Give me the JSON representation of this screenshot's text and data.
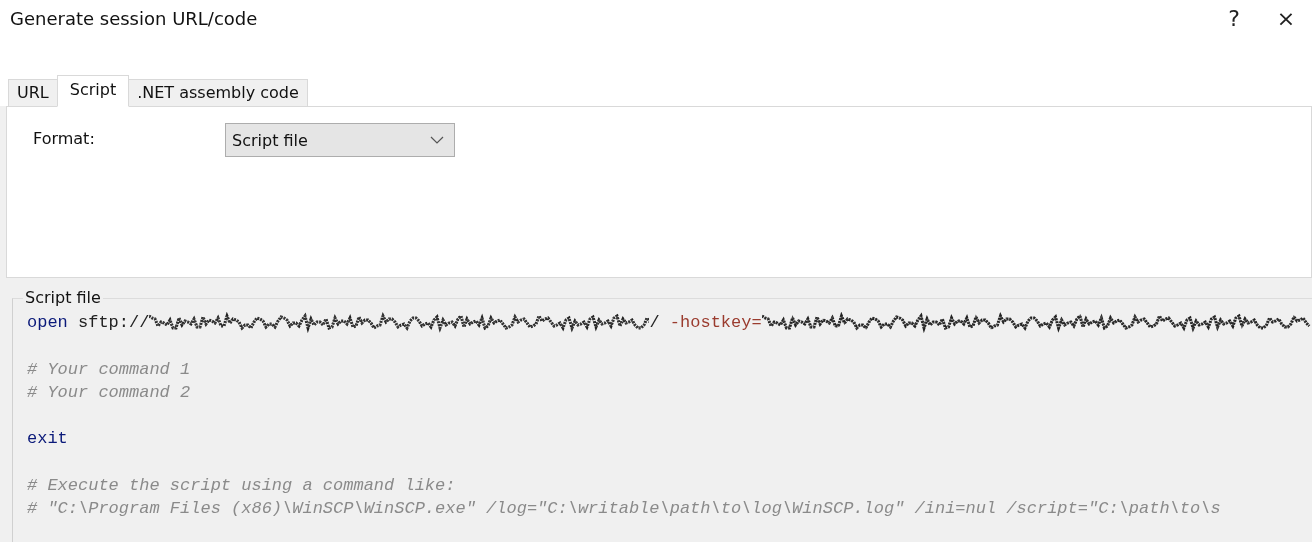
{
  "window": {
    "title": "Generate session URL/code",
    "help": "?",
    "close": "×"
  },
  "tabs": [
    {
      "label": "URL",
      "selected": false
    },
    {
      "label": "Script",
      "selected": true
    },
    {
      "label": ".NET assembly code",
      "selected": false
    }
  ],
  "format": {
    "label": "Format:",
    "value": "Script file"
  },
  "script": {
    "title": "Script file",
    "blocks": [
      {
        "lines": [
          {
            "segments": [
              {
                "kind": "keyword",
                "text": "open"
              },
              {
                "kind": "plain",
                "text": " sftp://"
              },
              {
                "kind": "redacted"
              },
              {
                "kind": "plain",
                "text": "/ "
              },
              {
                "kind": "option",
                "text": "-hostkey="
              },
              {
                "kind": "redacted"
              }
            ]
          }
        ]
      },
      {
        "lines": [
          {
            "segments": [
              {
                "kind": "comment",
                "text": "# Your command 1"
              }
            ]
          },
          {
            "segments": [
              {
                "kind": "comment",
                "text": "# Your command 2"
              }
            ]
          }
        ]
      },
      {
        "lines": [
          {
            "segments": [
              {
                "kind": "keyword",
                "text": "exit"
              }
            ]
          }
        ]
      },
      {
        "lines": [
          {
            "segments": [
              {
                "kind": "comment",
                "text": "# Execute the script using a command like:"
              }
            ]
          },
          {
            "segments": [
              {
                "kind": "comment",
                "text": "# \"C:\\Program Files (x86)\\WinSCP\\WinSCP.exe\" /log=\"C:\\writable\\path\\to\\log\\WinSCP.log\" /ini=nul /script=\"C:\\path\\to\\s"
              }
            ]
          }
        ]
      }
    ]
  }
}
